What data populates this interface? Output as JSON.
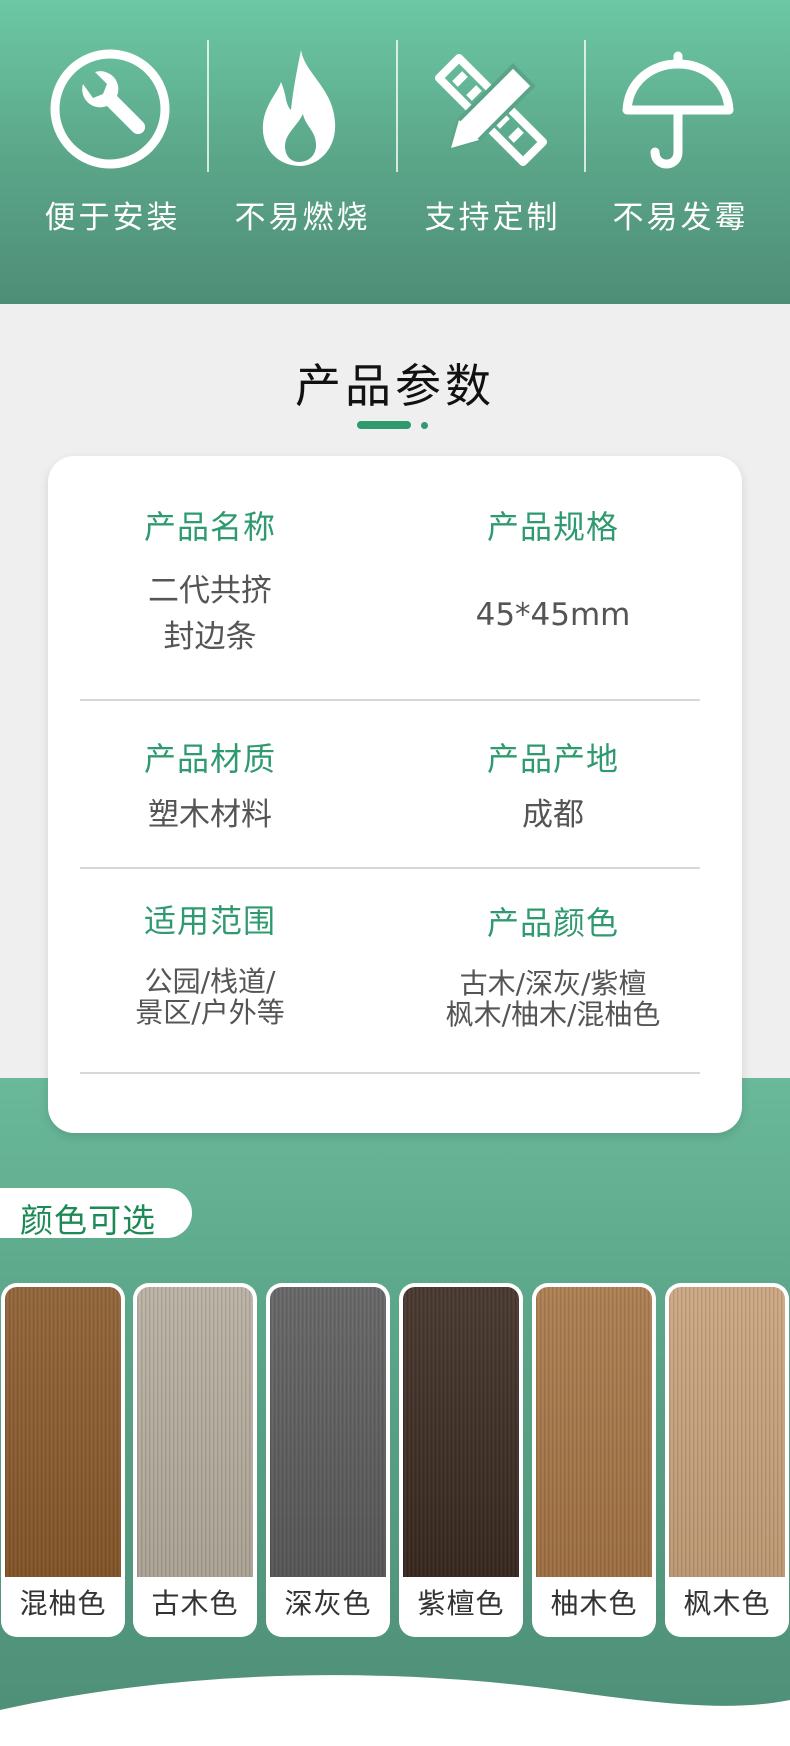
{
  "features": [
    {
      "label": "便于安装",
      "icon": "wrench-icon"
    },
    {
      "label": "不易燃烧",
      "icon": "flame-icon"
    },
    {
      "label": "支持定制",
      "icon": "pencil-ruler-icon"
    },
    {
      "label": "不易发霉",
      "icon": "umbrella-icon"
    }
  ],
  "params": {
    "title": "产品参数",
    "name_label": "产品名称",
    "name_line1": "二代共挤",
    "name_line2": "封边条",
    "spec_label": "产品规格",
    "spec_value": "45*45mm",
    "material_label": "产品材质",
    "material_value": "塑木材料",
    "origin_label": "产品产地",
    "origin_value": "成都",
    "scope_label": "适用范围",
    "scope_line1": "公园/栈道/",
    "scope_line2": "景区/户外等",
    "colors_label": "产品颜色",
    "colors_line1": "古木/深灰/紫檀",
    "colors_line2": "枫木/柚木/混柚色"
  },
  "colors": {
    "title": "颜色可选",
    "swatches": [
      {
        "name": "混柚色",
        "color": "#8b5a2b"
      },
      {
        "name": "古木色",
        "color": "#b6ad9e"
      },
      {
        "name": "深灰色",
        "color": "#5c5c5c"
      },
      {
        "name": "紫檀色",
        "color": "#3b2a20"
      },
      {
        "name": "柚木色",
        "color": "#a87646"
      },
      {
        "name": "枫木色",
        "color": "#c9a27a"
      }
    ]
  },
  "theme": {
    "accent": "#2f9a6f",
    "band": "#5aa488"
  }
}
